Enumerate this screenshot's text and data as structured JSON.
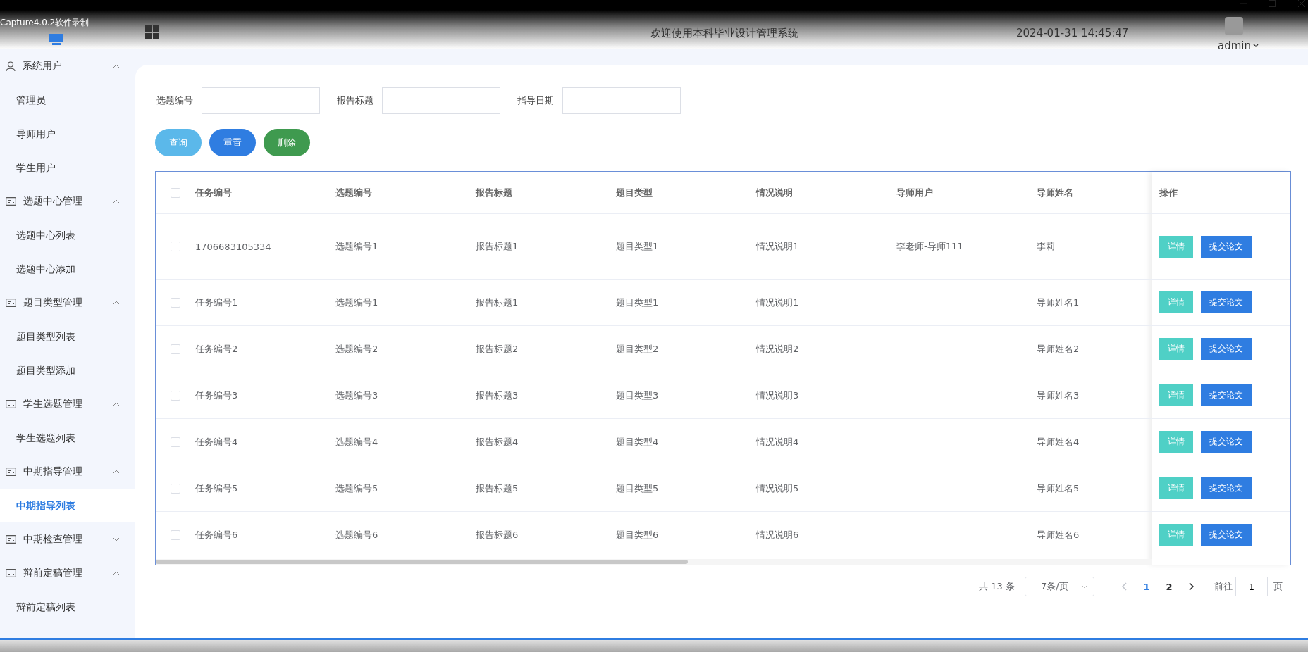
{
  "window": {
    "title": "Capture4.0.2软件录制"
  },
  "header": {
    "title": "欢迎使用本科毕业设计管理系统",
    "datetime": "2024-01-31 14:45:47",
    "user": "admin"
  },
  "sidebar": {
    "groups": [
      {
        "label": "系统用户",
        "kind": "user",
        "expanded": true,
        "children": [
          {
            "label": "管理员",
            "selected": false
          },
          {
            "label": "导师用户",
            "selected": false
          },
          {
            "label": "学生用户",
            "selected": false
          }
        ]
      },
      {
        "label": "选题中心管理",
        "kind": "module",
        "expanded": true,
        "children": [
          {
            "label": "选题中心列表",
            "selected": false
          },
          {
            "label": "选题中心添加",
            "selected": false
          }
        ]
      },
      {
        "label": "题目类型管理",
        "kind": "module",
        "expanded": true,
        "children": [
          {
            "label": "题目类型列表",
            "selected": false
          },
          {
            "label": "题目类型添加",
            "selected": false
          }
        ]
      },
      {
        "label": "学生选题管理",
        "kind": "module",
        "expanded": true,
        "children": [
          {
            "label": "学生选题列表",
            "selected": false
          }
        ]
      },
      {
        "label": "中期指导管理",
        "kind": "module",
        "expanded": true,
        "children": [
          {
            "label": "中期指导列表",
            "selected": true
          }
        ]
      },
      {
        "label": "中期检查管理",
        "kind": "module",
        "expanded": false
      },
      {
        "label": "辩前定稿管理",
        "kind": "module",
        "expanded": true,
        "children": [
          {
            "label": "辩前定稿列表",
            "selected": false
          }
        ]
      }
    ]
  },
  "search": {
    "fields": [
      {
        "label": "选题编号"
      },
      {
        "label": "报告标题"
      },
      {
        "label": "指导日期"
      }
    ],
    "buttons": [
      {
        "label": "查询",
        "kind": "query"
      },
      {
        "label": "重置",
        "kind": "reset"
      },
      {
        "label": "删除",
        "kind": "delete"
      }
    ]
  },
  "table": {
    "header_checked": false,
    "columns": [
      "任务编号",
      "选题编号",
      "报告标题",
      "题目类型",
      "情况说明",
      "导师用户",
      "导师姓名"
    ],
    "action_column": "操作",
    "rows": [
      {
        "checked": false,
        "cells": [
          "1706683105334",
          "选题编号1",
          "报告标题1",
          "题目类型1",
          "情况说明1",
          "李老师-导师111",
          "李莉"
        ],
        "actions": [
          "详情",
          "提交论文"
        ]
      },
      {
        "checked": false,
        "cells": [
          "任务编号1",
          "选题编号1",
          "报告标题1",
          "题目类型1",
          "情况说明1",
          "",
          "导师姓名1"
        ],
        "actions": [
          "详情",
          "提交论文"
        ]
      },
      {
        "checked": false,
        "cells": [
          "任务编号2",
          "选题编号2",
          "报告标题2",
          "题目类型2",
          "情况说明2",
          "",
          "导师姓名2"
        ],
        "actions": [
          "详情",
          "提交论文"
        ]
      },
      {
        "checked": false,
        "cells": [
          "任务编号3",
          "选题编号3",
          "报告标题3",
          "题目类型3",
          "情况说明3",
          "",
          "导师姓名3"
        ],
        "actions": [
          "详情",
          "提交论文"
        ]
      },
      {
        "checked": false,
        "cells": [
          "任务编号4",
          "选题编号4",
          "报告标题4",
          "题目类型4",
          "情况说明4",
          "",
          "导师姓名4"
        ],
        "actions": [
          "详情",
          "提交论文"
        ]
      },
      {
        "checked": false,
        "cells": [
          "任务编号5",
          "选题编号5",
          "报告标题5",
          "题目类型5",
          "情况说明5",
          "",
          "导师姓名5"
        ],
        "actions": [
          "详情",
          "提交论文"
        ]
      },
      {
        "checked": false,
        "cells": [
          "任务编号6",
          "选题编号6",
          "报告标题6",
          "题目类型6",
          "情况说明6",
          "",
          "导师姓名6"
        ],
        "actions": [
          "详情",
          "提交论文"
        ]
      }
    ]
  },
  "pagination": {
    "total": "共 13 条",
    "page_size": "7条/页",
    "pages": [
      {
        "label": "1",
        "selected": true
      },
      {
        "label": "2",
        "selected": false
      }
    ],
    "goto_label": "前往",
    "goto_value": "1",
    "goto_suffix": "页"
  }
}
